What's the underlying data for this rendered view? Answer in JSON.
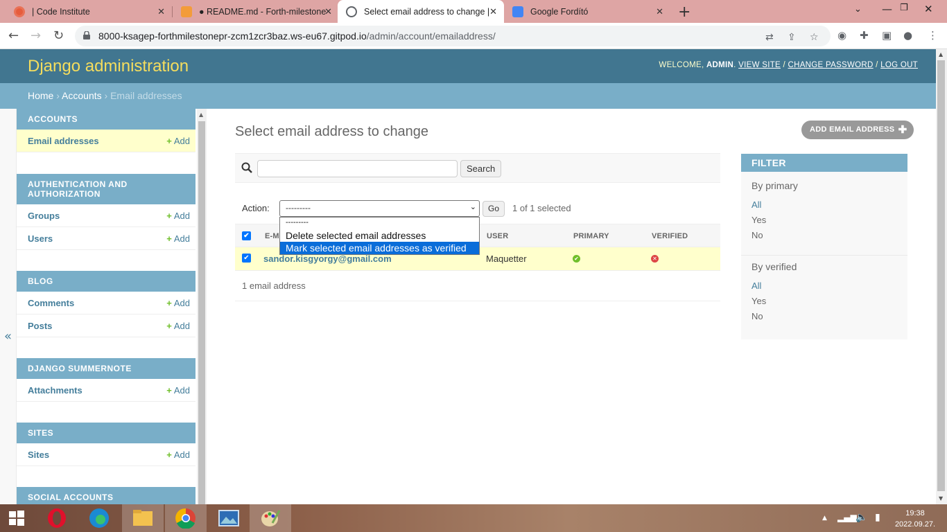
{
  "browser": {
    "tabs": [
      {
        "title": "| Code Institute"
      },
      {
        "title": "● README.md - Forth-milestone"
      },
      {
        "title": "Select email address to change |"
      },
      {
        "title": "Google Fordító"
      }
    ],
    "url_host": "8000-ksagep-forthmilestonepr-zcm1zcr3baz.ws-eu67.gitpod.io",
    "url_path": "/admin/account/emailaddress/"
  },
  "header": {
    "brand": "Django administration",
    "welcome": "WELCOME,",
    "user": "ADMIN",
    "view_site": "VIEW SITE",
    "change_password": "CHANGE PASSWORD",
    "log_out": "LOG OUT"
  },
  "breadcrumbs": {
    "home": "Home",
    "accounts": "Accounts",
    "current": "Email addresses"
  },
  "sidebar": {
    "toggle": "«",
    "add_label": "Add",
    "modules": [
      {
        "caption": "ACCOUNTS",
        "items": [
          "Email addresses"
        ]
      },
      {
        "caption": "AUTHENTICATION AND AUTHORIZATION",
        "items": [
          "Groups",
          "Users"
        ]
      },
      {
        "caption": "BLOG",
        "items": [
          "Comments",
          "Posts"
        ]
      },
      {
        "caption": "DJANGO SUMMERNOTE",
        "items": [
          "Attachments"
        ]
      },
      {
        "caption": "SITES",
        "items": [
          "Sites"
        ]
      },
      {
        "caption": "SOCIAL ACCOUNTS",
        "items": []
      }
    ]
  },
  "main": {
    "title": "Select email address to change",
    "add_button": "ADD EMAIL ADDRESS",
    "search_button": "Search",
    "search_value": "",
    "action_label": "Action:",
    "action_selected": "---------",
    "go_button": "Go",
    "selection_count": "1 of 1 selected",
    "action_options": [
      "---------",
      "Delete selected email addresses",
      "Mark selected email addresses as verified"
    ],
    "columns": [
      "E-M",
      "USER",
      "PRIMARY",
      "VERIFIED"
    ],
    "rows": [
      {
        "email": "sandor.kisgyorgy@gmail.com",
        "user": "Maquetter",
        "primary": true,
        "verified": false
      }
    ],
    "paginator": "1 email address"
  },
  "filter": {
    "title": "FILTER",
    "groups": [
      {
        "title": "By primary",
        "options": [
          "All",
          "Yes",
          "No"
        ],
        "selected": "All"
      },
      {
        "title": "By verified",
        "options": [
          "All",
          "Yes",
          "No"
        ],
        "selected": "All"
      }
    ]
  },
  "taskbar": {
    "time": "19:38",
    "date": "2022.09.27."
  },
  "colors": {
    "header": "#417690",
    "brand": "#f5dd5d",
    "accent": "#79aec8",
    "link": "#447e9b",
    "highlight_row": "#ffffcc"
  }
}
